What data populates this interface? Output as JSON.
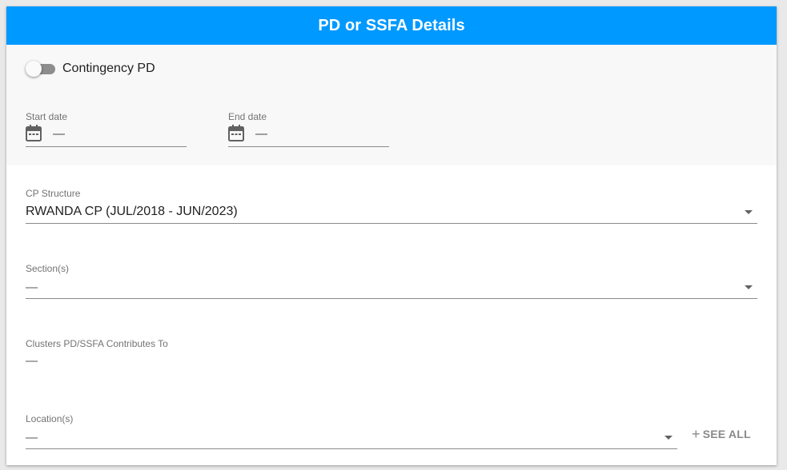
{
  "header": {
    "title": "PD or SSFA Details"
  },
  "contingency": {
    "label": "Contingency PD",
    "enabled": false
  },
  "start_date": {
    "label": "Start date",
    "value": "—"
  },
  "end_date": {
    "label": "End date",
    "value": "—"
  },
  "cp_structure": {
    "label": "CP Structure",
    "value": "RWANDA CP (JUL/2018 - JUN/2023)"
  },
  "sections": {
    "label": "Section(s)",
    "value": "—"
  },
  "clusters": {
    "label": "Clusters PD/SSFA Contributes To",
    "value": "—"
  },
  "locations": {
    "label": "Location(s)",
    "value": "—",
    "see_all": "SEE ALL"
  },
  "colors": {
    "header_bg": "#0099ff",
    "gray_section": "#f8f8f8"
  }
}
